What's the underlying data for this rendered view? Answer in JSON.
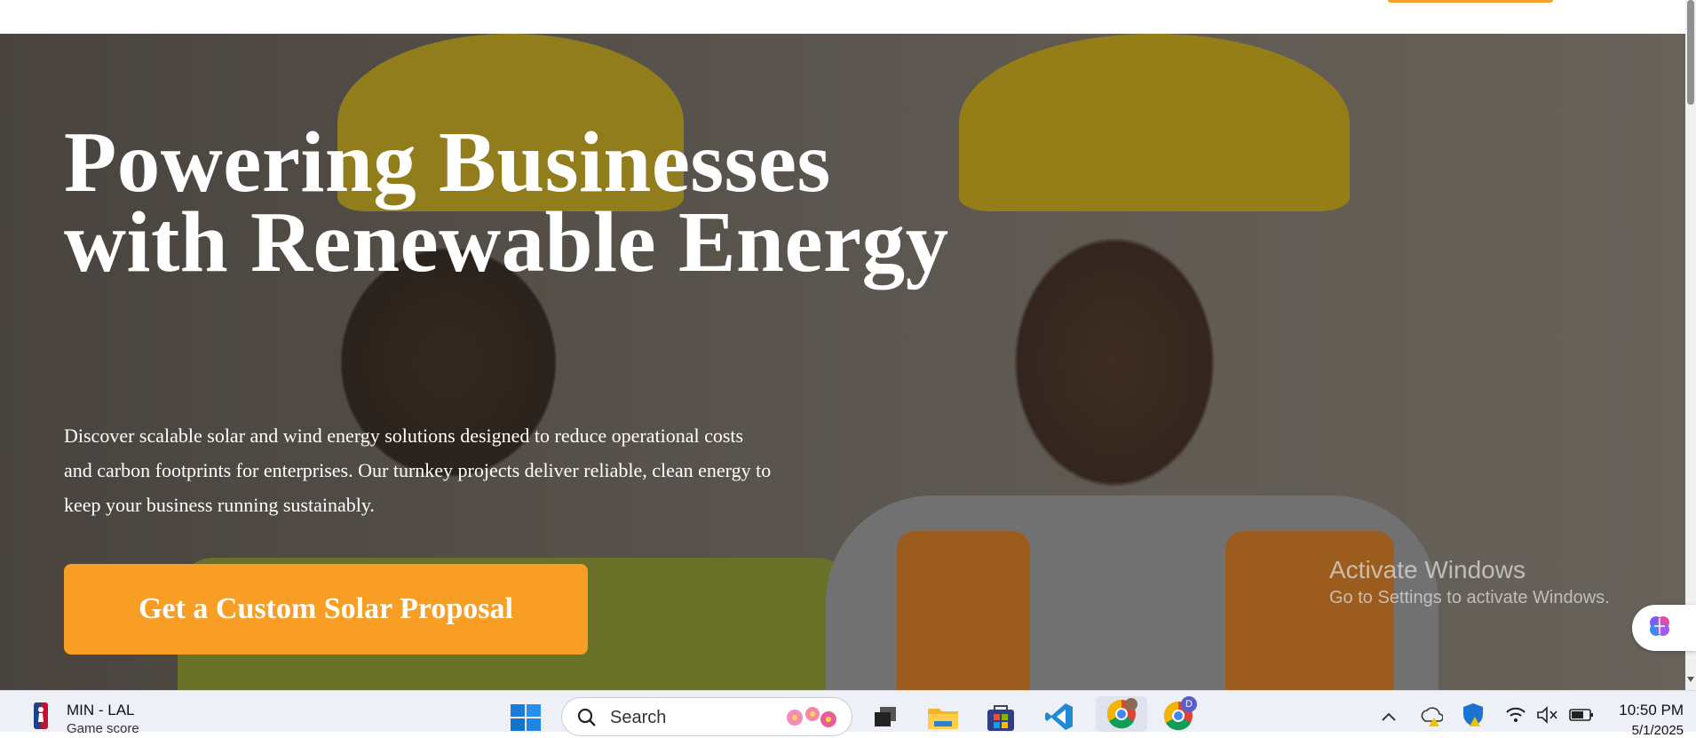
{
  "hero": {
    "title": "Powering Businesses with Renewable Energy",
    "description": "Discover scalable solar and wind energy solutions designed to reduce operational costs and carbon footprints for enterprises. Our turnkey projects deliver reliable, clean energy to keep your business running sustainably.",
    "cta_label": "Get a Custom Solar Proposal"
  },
  "watermark": {
    "line1": "Activate Windows",
    "line2": "Go to Settings to activate Windows."
  },
  "taskbar": {
    "widget_title": "MIN - LAL",
    "widget_subtitle": "Game score",
    "search_placeholder": "Search",
    "time": "10:50 PM",
    "date": "5/1/2025",
    "chrome_profile_badge": "D"
  },
  "colors": {
    "accent": "#f99e24",
    "taskbar_bg": "#eef0f8"
  }
}
